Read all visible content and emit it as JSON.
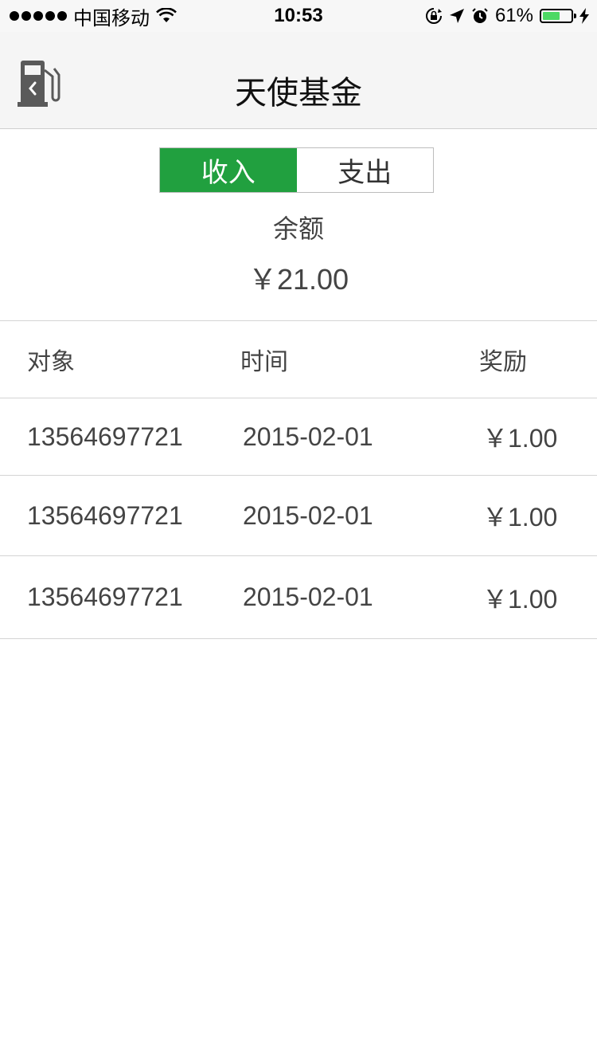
{
  "status_bar": {
    "carrier": "中国移动",
    "time": "10:53",
    "battery_percent": "61%",
    "battery_level": 0.61,
    "battery_color": "#4cd964",
    "icons": [
      "signal-dots-icon",
      "wifi-icon",
      "rotation-lock-icon",
      "location-arrow-icon",
      "alarm-icon",
      "battery-icon",
      "charging-bolt-icon"
    ]
  },
  "nav": {
    "title": "天使基金",
    "back_icon": "fuel-pump-back-icon"
  },
  "segment": {
    "tabs": [
      {
        "label": "收入",
        "active": true
      },
      {
        "label": "支出",
        "active": false
      }
    ],
    "active_color": "#21a03f"
  },
  "balance": {
    "label": "余额",
    "value": "￥21.00"
  },
  "table": {
    "columns": [
      "对象",
      "时间",
      "奖励"
    ],
    "rows": [
      [
        "13564697721",
        "2015-02-01",
        "￥1.00"
      ],
      [
        "13564697721",
        "2015-02-01",
        "￥1.00"
      ],
      [
        "13564697721",
        "2015-02-01",
        "￥1.00"
      ]
    ]
  }
}
